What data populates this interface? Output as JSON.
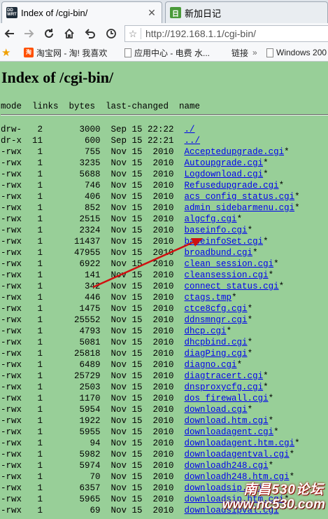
{
  "tabs": [
    {
      "title": "Index of /cgi-bin/",
      "icon": "dd-wrt-icon",
      "active": true
    },
    {
      "title": "新加日记",
      "icon": "blog-icon",
      "active": false
    }
  ],
  "navbar": {
    "url": "http://192.168.1.1/cgi-bin/"
  },
  "bookmarks": [
    {
      "label": "淘宝网 - 淘! 我喜欢"
    },
    {
      "label": "应用中心 - 电费 水..."
    },
    {
      "label": "链接"
    },
    {
      "label": "Windows 200"
    }
  ],
  "page": {
    "title": "Index of /cgi-bin/",
    "header": "mode  links  bytes  last-changed  name",
    "rows": [
      {
        "mode": "drw-",
        "links": "2",
        "bytes": "3000",
        "date": "Sep 15 22:22",
        "name": "./",
        "flag": ""
      },
      {
        "mode": "dr-x",
        "links": "11",
        "bytes": "600",
        "date": "Sep 15 22:21",
        "name": "../",
        "flag": ""
      },
      {
        "mode": "-rwx",
        "links": "1",
        "bytes": "755",
        "date": "Nov 15  2010",
        "name": "Acceptedupgrade.cgi",
        "flag": "*"
      },
      {
        "mode": "-rwx",
        "links": "1",
        "bytes": "3235",
        "date": "Nov 15  2010",
        "name": "Autoupgrade.cgi",
        "flag": "*"
      },
      {
        "mode": "-rwx",
        "links": "1",
        "bytes": "5688",
        "date": "Nov 15  2010",
        "name": "Logdownload.cgi",
        "flag": "*"
      },
      {
        "mode": "-rwx",
        "links": "1",
        "bytes": "746",
        "date": "Nov 15  2010",
        "name": "Refusedupgrade.cgi",
        "flag": "*"
      },
      {
        "mode": "-rwx",
        "links": "1",
        "bytes": "406",
        "date": "Nov 15  2010",
        "name": "acs_config_status.cgi",
        "flag": "*"
      },
      {
        "mode": "-rwx",
        "links": "1",
        "bytes": "852",
        "date": "Nov 15  2010",
        "name": "admin_sidebarmenu.cgi",
        "flag": "*"
      },
      {
        "mode": "-rwx",
        "links": "1",
        "bytes": "2515",
        "date": "Nov 15  2010",
        "name": "algcfg.cgi",
        "flag": "*"
      },
      {
        "mode": "-rwx",
        "links": "1",
        "bytes": "2324",
        "date": "Nov 15  2010",
        "name": "baseinfo.cgi",
        "flag": "*"
      },
      {
        "mode": "-rwx",
        "links": "1",
        "bytes": "11437",
        "date": "Nov 15  2010",
        "name": "baseinfoSet.cgi",
        "flag": "*"
      },
      {
        "mode": "-rwx",
        "links": "1",
        "bytes": "47955",
        "date": "Nov 15  2010",
        "name": "broadbund.cgi",
        "flag": "*"
      },
      {
        "mode": "-rwx",
        "links": "1",
        "bytes": "6922",
        "date": "Nov 15  2010",
        "name": "clean_session.cgi",
        "flag": "*"
      },
      {
        "mode": "-rwx",
        "links": "1",
        "bytes": "141",
        "date": "Nov 15  2010",
        "name": "cleansession.cgi",
        "flag": "*"
      },
      {
        "mode": "-rwx",
        "links": "1",
        "bytes": "342",
        "date": "Nov 15  2010",
        "name": "connect_status.cgi",
        "flag": "*"
      },
      {
        "mode": "-rwx",
        "links": "1",
        "bytes": "446",
        "date": "Nov 15  2010",
        "name": "ctags.tmp",
        "flag": "*"
      },
      {
        "mode": "-rwx",
        "links": "1",
        "bytes": "1475",
        "date": "Nov 15  2010",
        "name": "ctce8cfg.cgi",
        "flag": "*"
      },
      {
        "mode": "-rwx",
        "links": "1",
        "bytes": "25552",
        "date": "Nov 15  2010",
        "name": "ddnsmngr.cgi",
        "flag": "*"
      },
      {
        "mode": "-rwx",
        "links": "1",
        "bytes": "4793",
        "date": "Nov 15  2010",
        "name": "dhcp.cgi",
        "flag": "*"
      },
      {
        "mode": "-rwx",
        "links": "1",
        "bytes": "5081",
        "date": "Nov 15  2010",
        "name": "dhcpbind.cgi",
        "flag": "*"
      },
      {
        "mode": "-rwx",
        "links": "1",
        "bytes": "25818",
        "date": "Nov 15  2010",
        "name": "diagPing.cgi",
        "flag": "*"
      },
      {
        "mode": "-rwx",
        "links": "1",
        "bytes": "6489",
        "date": "Nov 15  2010",
        "name": "diagno.cgi",
        "flag": "*"
      },
      {
        "mode": "-rwx",
        "links": "1",
        "bytes": "25729",
        "date": "Nov 15  2010",
        "name": "diagtracert.cgi",
        "flag": "*"
      },
      {
        "mode": "-rwx",
        "links": "1",
        "bytes": "2503",
        "date": "Nov 15  2010",
        "name": "dnsproxycfg.cgi",
        "flag": "*"
      },
      {
        "mode": "-rwx",
        "links": "1",
        "bytes": "1170",
        "date": "Nov 15  2010",
        "name": "dos_firewall.cgi",
        "flag": "*"
      },
      {
        "mode": "-rwx",
        "links": "1",
        "bytes": "5954",
        "date": "Nov 15  2010",
        "name": "download.cgi",
        "flag": "*"
      },
      {
        "mode": "-rwx",
        "links": "1",
        "bytes": "1922",
        "date": "Nov 15  2010",
        "name": "download.htm.cgi",
        "flag": "*"
      },
      {
        "mode": "-rwx",
        "links": "1",
        "bytes": "5955",
        "date": "Nov 15  2010",
        "name": "downloadagent.cgi",
        "flag": "*"
      },
      {
        "mode": "-rwx",
        "links": "1",
        "bytes": "94",
        "date": "Nov 15  2010",
        "name": "downloadagent.htm.cgi",
        "flag": "*"
      },
      {
        "mode": "-rwx",
        "links": "1",
        "bytes": "5982",
        "date": "Nov 15  2010",
        "name": "downloadagentval.cgi",
        "flag": "*"
      },
      {
        "mode": "-rwx",
        "links": "1",
        "bytes": "5974",
        "date": "Nov 15  2010",
        "name": "downloadh248.cgi",
        "flag": "*"
      },
      {
        "mode": "-rwx",
        "links": "1",
        "bytes": "70",
        "date": "Nov 15  2010",
        "name": "downloadh248.htm.cgi",
        "flag": "*"
      },
      {
        "mode": "-rwx",
        "links": "1",
        "bytes": "6357",
        "date": "Nov 15  2010",
        "name": "downloadsip.cgi",
        "flag": "*"
      },
      {
        "mode": "-rwx",
        "links": "1",
        "bytes": "5965",
        "date": "Nov 15  2010",
        "name": "downloadsip.htm.cgi",
        "flag": "*"
      },
      {
        "mode": "-rwx",
        "links": "1",
        "bytes": "69",
        "date": "Nov 15  2010",
        "name": "downloadsipval.cgi",
        "flag": "*"
      }
    ]
  },
  "watermark": {
    "line1": "南昌530论坛",
    "line2": "www.nc530.com"
  },
  "colors": {
    "page_bg": "#98cf98",
    "link": "#0000ee",
    "annotation_arrow": "#d01010"
  }
}
